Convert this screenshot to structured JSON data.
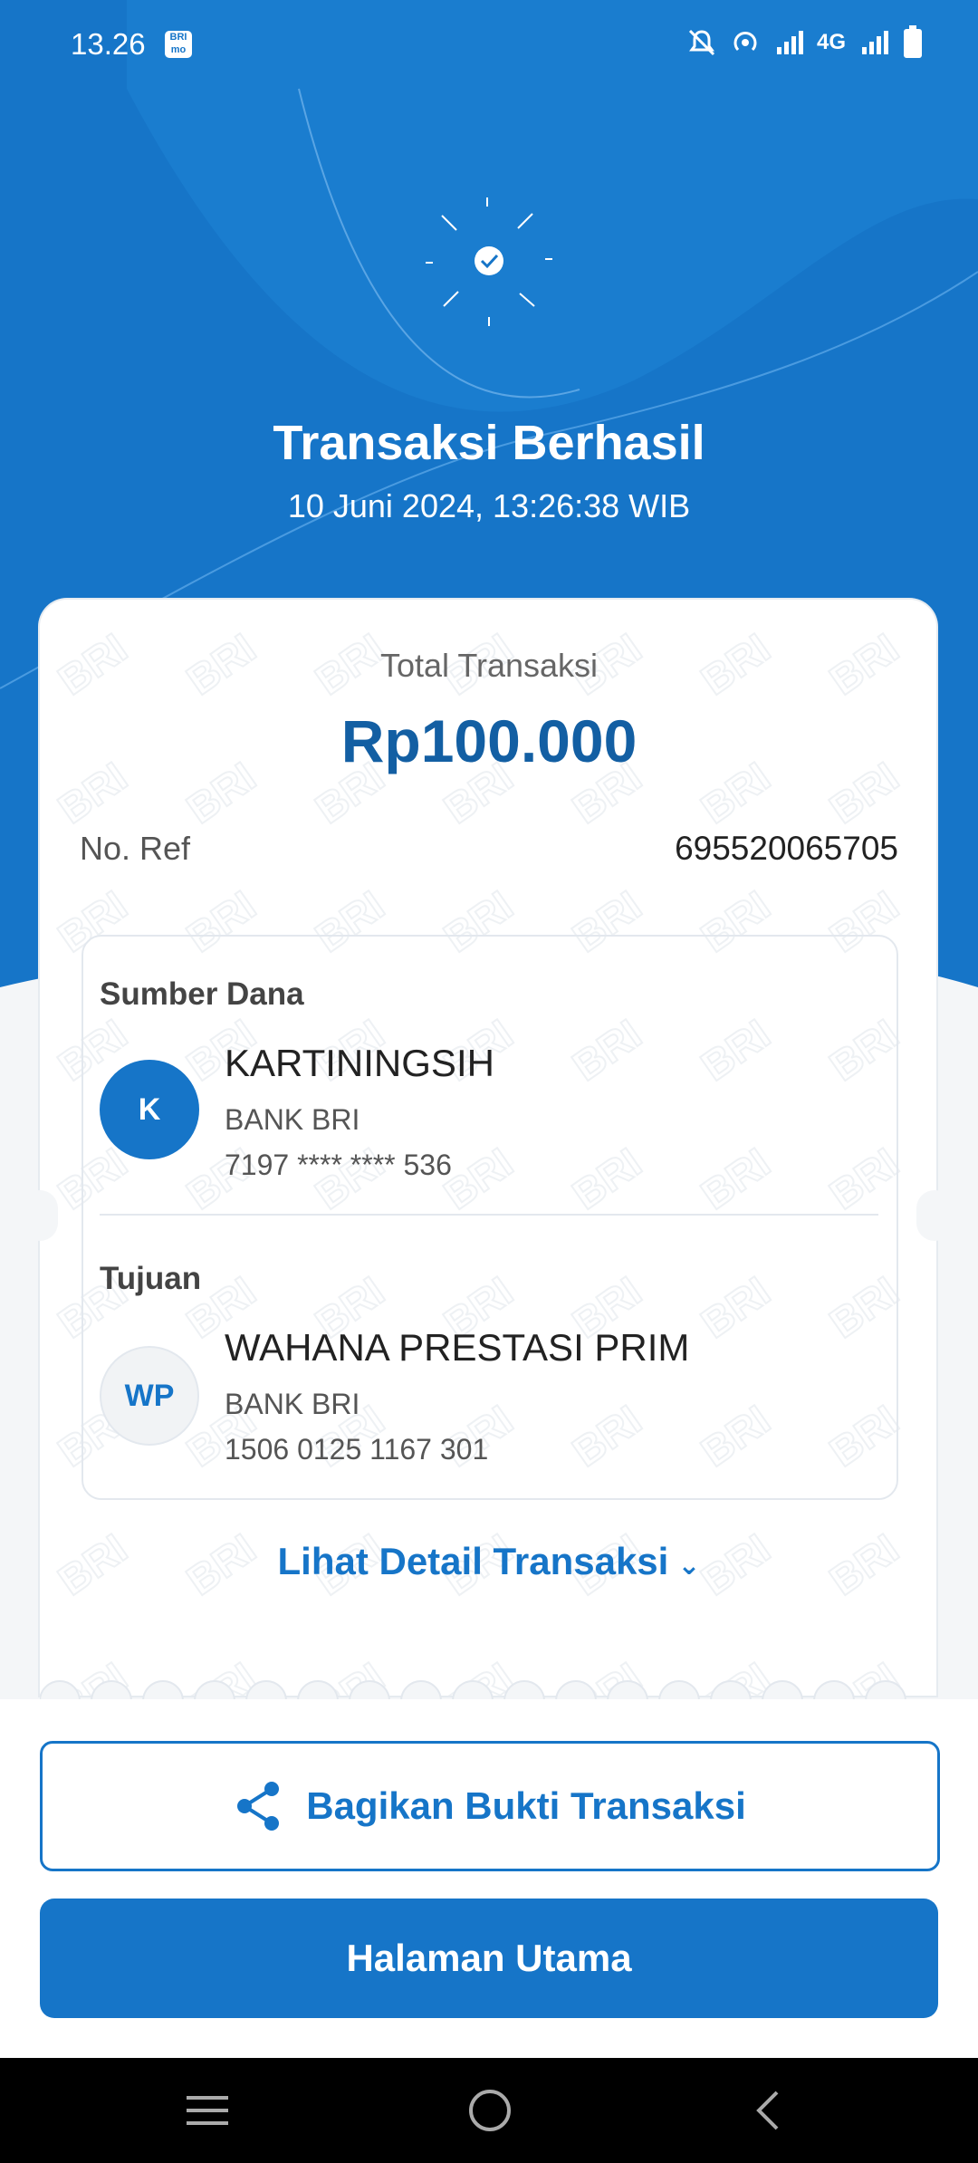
{
  "status_bar": {
    "time": "13.26",
    "app_badge": "BRI mo",
    "network": "4G",
    "icons": [
      "mute-icon",
      "hotspot-icon",
      "signal-icon",
      "signal-icon",
      "battery-icon"
    ]
  },
  "header": {
    "title": "Transaksi Berhasil",
    "datetime": "10 Juni 2024, 13:26:38 WIB"
  },
  "receipt": {
    "total_label": "Total Transaksi",
    "amount": "Rp100.000",
    "ref_label": "No. Ref",
    "ref_value": "695520065705",
    "watermark": "BRI",
    "source": {
      "section_label": "Sumber Dana",
      "initial": "K",
      "name": "KARTININGSIH",
      "bank": "BANK BRI",
      "account": "7197 **** **** 536"
    },
    "destination": {
      "section_label": "Tujuan",
      "initial": "WP",
      "name": "WAHANA PRESTASI PRIM",
      "bank": "BANK BRI",
      "account": "1506 0125 1167 301"
    },
    "detail_link": "Lihat Detail Transaksi"
  },
  "actions": {
    "share_label": "Bagikan Bukti Transaksi",
    "home_label": "Halaman Utama"
  },
  "colors": {
    "primary": "#1675c8",
    "amount": "#135fa3"
  }
}
